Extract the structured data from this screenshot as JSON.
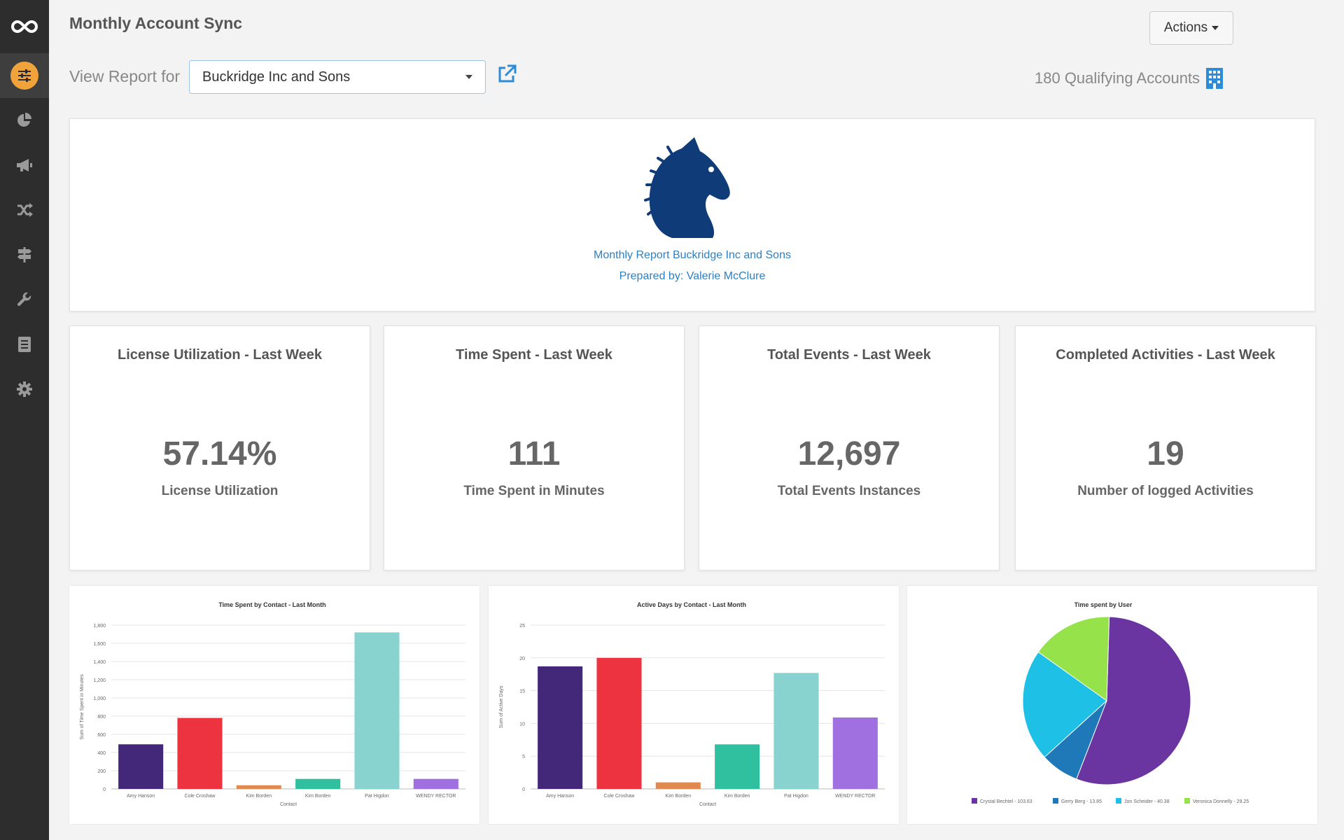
{
  "page": {
    "title": "Monthly Account Sync"
  },
  "toolbar": {
    "actions_label": "Actions",
    "view_label": "View Report for",
    "selected_account": "Buckridge Inc and Sons",
    "qualifying": "180 Qualifying Accounts"
  },
  "sidebar": {
    "items": [
      {
        "icon": "sliders-icon",
        "active": true
      },
      {
        "icon": "pie-chart-icon"
      },
      {
        "icon": "megaphone-icon"
      },
      {
        "icon": "shuffle-icon"
      },
      {
        "icon": "signpost-icon"
      },
      {
        "icon": "wrench-icon"
      },
      {
        "icon": "list-icon"
      },
      {
        "icon": "gear-icon"
      }
    ]
  },
  "report": {
    "line1": "Monthly Report Buckridge Inc and Sons",
    "line2": "Prepared by: Valerie McClure"
  },
  "kpis": [
    {
      "title": "License Utilization - Last Week",
      "value": "57.14%",
      "sub": "License Utilization"
    },
    {
      "title": "Time Spent - Last Week",
      "value": "111",
      "sub": "Time Spent in Minutes"
    },
    {
      "title": "Total Events - Last Week",
      "value": "12,697",
      "sub": "Total Events Instances"
    },
    {
      "title": "Completed Activities - Last Week",
      "value": "19",
      "sub": "Number of logged Activities"
    }
  ],
  "colors": {
    "accent": "#f0a33a",
    "link": "#2e7fc2",
    "series": [
      "#43287a",
      "#ee3340",
      "#e08a50",
      "#30c0a0",
      "#88d3cf",
      "#a070e0"
    ]
  },
  "chart_data": [
    {
      "type": "bar",
      "title": "Time Spent by Contact - Last Month",
      "xlabel": "Contact",
      "ylabel": "Sum of Time Spent in Minutes",
      "categories": [
        "Amy Hanson",
        "Cole Croshaw",
        "Kim Borden",
        "Kim Borden",
        "Pat Higdon",
        "WENDY RECTOR"
      ],
      "values": [
        490,
        780,
        40,
        110,
        1720,
        110
      ],
      "ylim": [
        0,
        1800
      ],
      "yticks": [
        "0",
        "200",
        "400",
        "600",
        "800",
        "1,000",
        "1,200",
        "1,400",
        "1,600",
        "1,800"
      ],
      "grid": true
    },
    {
      "type": "bar",
      "title": "Active Days by Contact - Last Month",
      "xlabel": "Contact",
      "ylabel": "Sum of Active Days",
      "categories": [
        "Amy Hanson",
        "Cole Croshaw",
        "Kim Borden",
        "Kim Borden",
        "Pat Higdon",
        "WENDY RECTOR"
      ],
      "values": [
        18.7,
        20,
        1,
        6.8,
        17.7,
        10.9
      ],
      "ylim": [
        0,
        25
      ],
      "yticks": [
        "0",
        "5",
        "10",
        "15",
        "20",
        "25"
      ],
      "grid": true
    },
    {
      "type": "pie",
      "title": "Time spent by User",
      "slices": [
        {
          "label": "Crystal Bechtel - 103.63",
          "value": 103.63,
          "color": "#6a35a0"
        },
        {
          "label": "Gerry Berg - 13.85",
          "value": 13.85,
          "color": "#1f78b8"
        },
        {
          "label": "Jon Scheider - 40.38",
          "value": 40.38,
          "color": "#1ec0e6"
        },
        {
          "label": "Veronica Donnelly - 29.25",
          "value": 29.25,
          "color": "#95e24a"
        }
      ],
      "legend": "bottom"
    }
  ]
}
